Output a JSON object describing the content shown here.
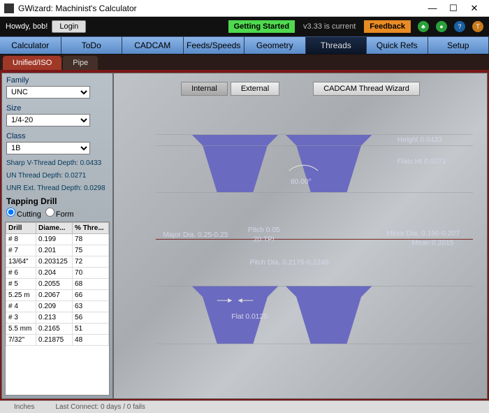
{
  "window": {
    "title": "GWizard: Machinist's Calculator",
    "min": "—",
    "max": "☐",
    "close": "✕"
  },
  "topbar": {
    "greeting": "Howdy, bob!",
    "login": "Login",
    "getting_started": "Getting Started",
    "version": "v3.33 is current",
    "feedback": "Feedback"
  },
  "tabs": {
    "items": [
      "Calculator",
      "ToDo",
      "CADCAM",
      "Feeds/Speeds",
      "Geometry",
      "Threads",
      "Quick Refs",
      "Setup"
    ],
    "active": 5
  },
  "subtabs": {
    "items": [
      "Unified/ISO",
      "Pipe"
    ],
    "active": 0
  },
  "form": {
    "family_label": "Family",
    "family_value": "UNC",
    "size_label": "Size",
    "size_value": "1/4-20",
    "class_label": "Class",
    "class_value": "1B"
  },
  "thread_info": {
    "sharp_v": "Sharp V-Thread Depth: 0.0433",
    "un": "UN Thread Depth: 0.0271",
    "unr": "UNR Ext. Thread Depth: 0.0298"
  },
  "tapping": {
    "header": "Tapping Drill",
    "cutting": "Cutting",
    "form": "Form",
    "cols": [
      "Drill",
      "Diame...",
      "% Thre..."
    ],
    "rows": [
      [
        "# 8",
        "0.199",
        "78"
      ],
      [
        "# 7",
        "0.201",
        "75"
      ],
      [
        "13/64\"",
        "0.203125",
        "72"
      ],
      [
        "# 6",
        "0.204",
        "70"
      ],
      [
        "# 5",
        "0.2055",
        "68"
      ],
      [
        "5.25 m",
        "0.2067",
        "66"
      ],
      [
        "# 4",
        "0.209",
        "63"
      ],
      [
        "# 3",
        "0.213",
        "56"
      ],
      [
        "5.5 mm",
        "0.2165",
        "51"
      ],
      [
        "7/32\"",
        "0.21875",
        "48"
      ]
    ]
  },
  "diagram_buttons": {
    "internal": "Internal",
    "external": "External",
    "wizard": "CADCAM Thread Wizard"
  },
  "diagram_labels": {
    "height": "Height 0.0433",
    "flats_ht": "Flats Ht 0.0271",
    "angle": "60.00°",
    "major": "Major Dia. 0.25-0.25",
    "minor": "Minor Dia. 0.196-0.207",
    "mean": "Mean 0.2015",
    "pitch": "Pitch 0.05",
    "tpi": "20 TPI",
    "pitch_dia": "Pitch Dia. 0.2175-0.2248",
    "flat": "Flat 0.0125"
  },
  "status": {
    "units": "Inches",
    "connect": "Last Connect: 0 days / 0 fails"
  }
}
